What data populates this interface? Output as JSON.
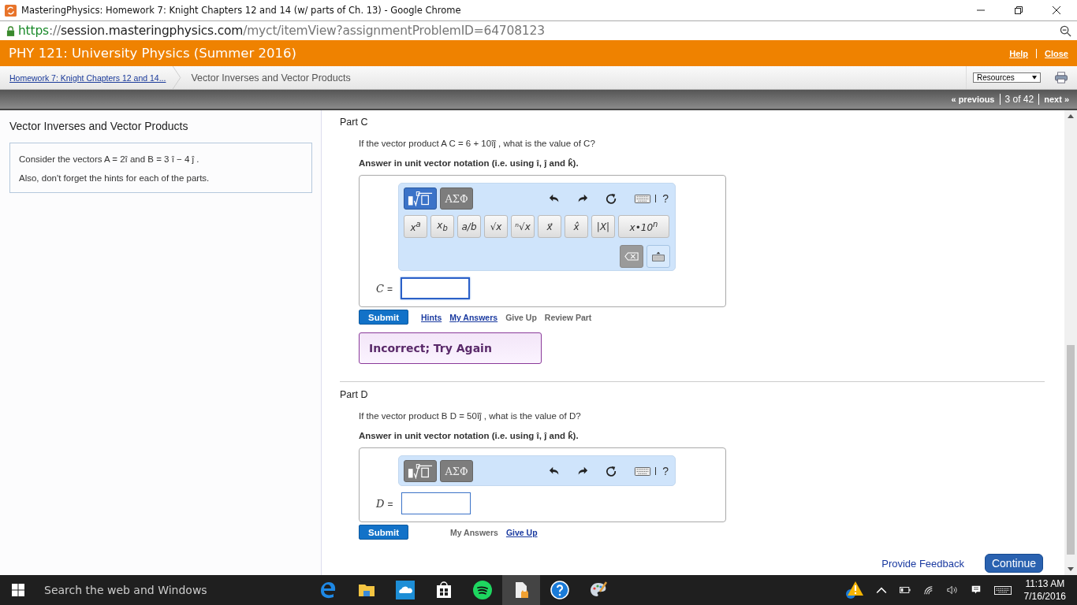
{
  "browser": {
    "title": "MasteringPhysics: Homework 7: Knight Chapters 12 and 14 (w/ parts of Ch. 13) - Google Chrome",
    "url": {
      "scheme": "https",
      "separator": "://",
      "host": "session.masteringphysics.com",
      "path": "/myct/itemView?assignmentProblemID=64708123"
    }
  },
  "header": {
    "course": "PHY 121: University Physics (Summer 2016)",
    "links": [
      "Help",
      "Close"
    ]
  },
  "breadcrumb": {
    "link": "Homework 7: Knight Chapters 12 and 14...",
    "current": "Vector Inverses and Vector Products",
    "resources": "Resources"
  },
  "pager": {
    "previous": "« previous",
    "position": "3 of 42",
    "next": "next »"
  },
  "sidebar": {
    "title": "Vector Inverses and Vector Products",
    "lines": [
      "Consider the vectors A = 2î and B = 3 î − 4 ĵ .",
      "Also, don't forget the hints for each of the parts."
    ]
  },
  "parts": [
    {
      "title": "Part C",
      "question": "If the vector product A C = 6 + 10îĵ , what is the value of C?",
      "instruction": "Answer in unit vector notation (i.e. using î, ĵ and k̂).",
      "modes": [
        {
          "kind": "template",
          "selected": true
        },
        {
          "kind": "symbols",
          "label": "ΑΣΦ",
          "selected": false
        }
      ],
      "help": "?",
      "keypad_open": true,
      "keys": [
        "x$^{a}$",
        "x$_{b}$",
        "a/b",
        "√x",
        "ⁿ√x",
        "x⃗",
        "x̂",
        "|X|",
        "x•10$^{n}$"
      ],
      "variable": "C",
      "equals": "=",
      "focused": true,
      "submit": "Submit",
      "actions": [
        {
          "label": "Hints",
          "kind": "link"
        },
        {
          "label": "My Answers",
          "kind": "link"
        },
        {
          "label": "Give Up",
          "kind": "plain"
        },
        {
          "label": "Review Part",
          "kind": "plain"
        }
      ],
      "feedback": "Incorrect; Try Again"
    },
    {
      "title": "Part D",
      "question": "If the vector product B D = 50îĵ , what is the value of D?",
      "instruction": "Answer in unit vector notation (i.e. using î, ĵ and k̂).",
      "modes": [
        {
          "kind": "template",
          "selected": false
        },
        {
          "kind": "symbols",
          "label": "ΑΣΦ",
          "selected": false
        }
      ],
      "help": "?",
      "keypad_open": false,
      "variable": "D",
      "equals": "=",
      "focused": false,
      "submit": "Submit",
      "actions": [
        {
          "label": "My Answers",
          "kind": "plain"
        },
        {
          "label": "Give Up",
          "kind": "link"
        }
      ]
    }
  ],
  "footer": {
    "feedback": "Provide Feedback",
    "continue": "Continue"
  },
  "taskbar": {
    "search": "Search the web and Windows",
    "time": "11:13 AM",
    "date": "7/16/2016"
  }
}
